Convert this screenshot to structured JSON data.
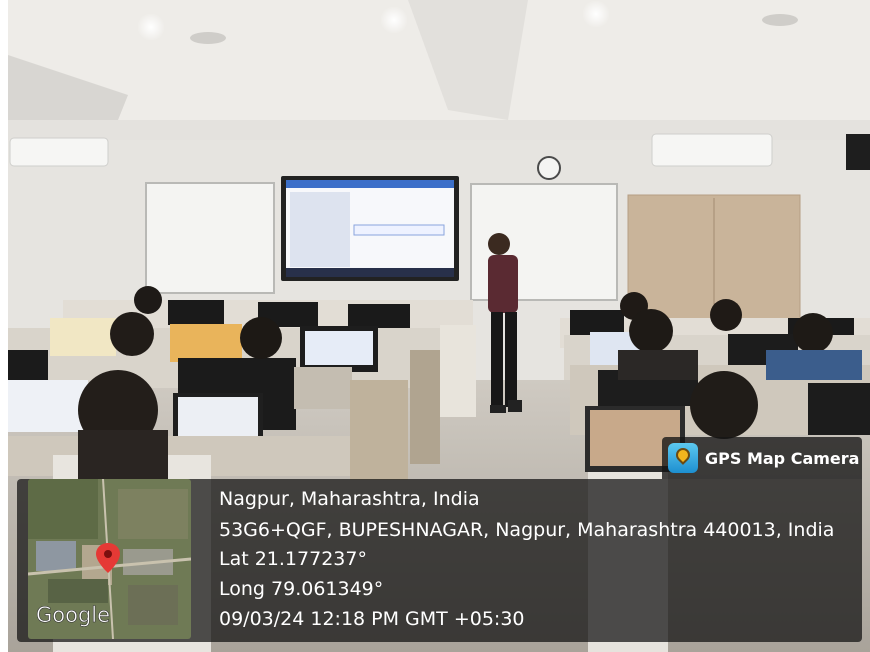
{
  "gps_badge": {
    "label": "GPS Map Camera",
    "icon": "gps-pin-icon"
  },
  "location": {
    "place": "Nagpur, Maharashtra, India",
    "address": "53G6+QGF, BUPESHNAGAR, Nagpur, Maharashtra 440013, India",
    "lat": "Lat 21.177237°",
    "long": "Long 79.061349°",
    "datetime": "09/03/24 12:18 PM GMT +05:30"
  },
  "map": {
    "brand": "Google",
    "marker_color": "#e53935"
  },
  "colors": {
    "overlay": "#141414",
    "wall": "#e6e4e0",
    "ceiling": "#f3f2ef"
  }
}
